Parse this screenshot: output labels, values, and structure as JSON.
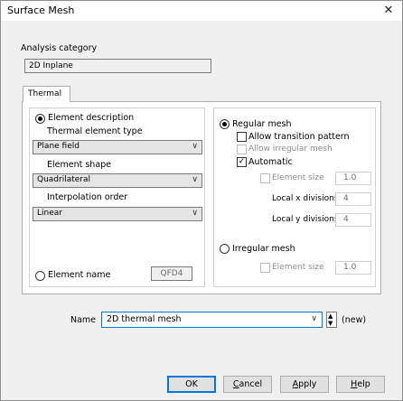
{
  "window": {
    "title": "Surface Mesh",
    "close": "✕"
  },
  "analysis": {
    "label": "Analysis category",
    "value": "2D Inplane"
  },
  "tabs": [
    {
      "label": "Thermal"
    }
  ],
  "left": {
    "element_description_label": "Element description",
    "thermal_type_label": "Thermal element type",
    "thermal_type_value": "Plane field",
    "shape_label": "Element shape",
    "shape_value": "Quadrilateral",
    "interp_label": "Interpolation order",
    "interp_value": "Linear",
    "element_name_label": "Element name",
    "element_name_value": "QFD4"
  },
  "right": {
    "regular_label": "Regular mesh",
    "allow_transition": "Allow transition pattern",
    "allow_irregular": "Allow irregular mesh",
    "automatic": "Automatic",
    "element_size_label": "Element size",
    "element_size_value": "1.0",
    "local_x_label": "Local x divisions",
    "local_x_value": "4",
    "local_y_label": "Local y divisions",
    "local_y_value": "4",
    "irregular_label": "Irregular mesh",
    "irr_element_size_label": "Element size",
    "irr_element_size_value": "1.0"
  },
  "name": {
    "label": "Name",
    "value": "2D thermal mesh",
    "suffix": "(new)"
  },
  "buttons": {
    "ok": "OK",
    "cancel_first": "C",
    "cancel_rest": "ancel",
    "apply_first": "A",
    "apply_rest": "pply",
    "help_first": "H",
    "help_rest": "elp"
  },
  "icons": {
    "chevron": "∨",
    "check": "✓",
    "spin_up": "▲",
    "spin_down": "▼"
  }
}
